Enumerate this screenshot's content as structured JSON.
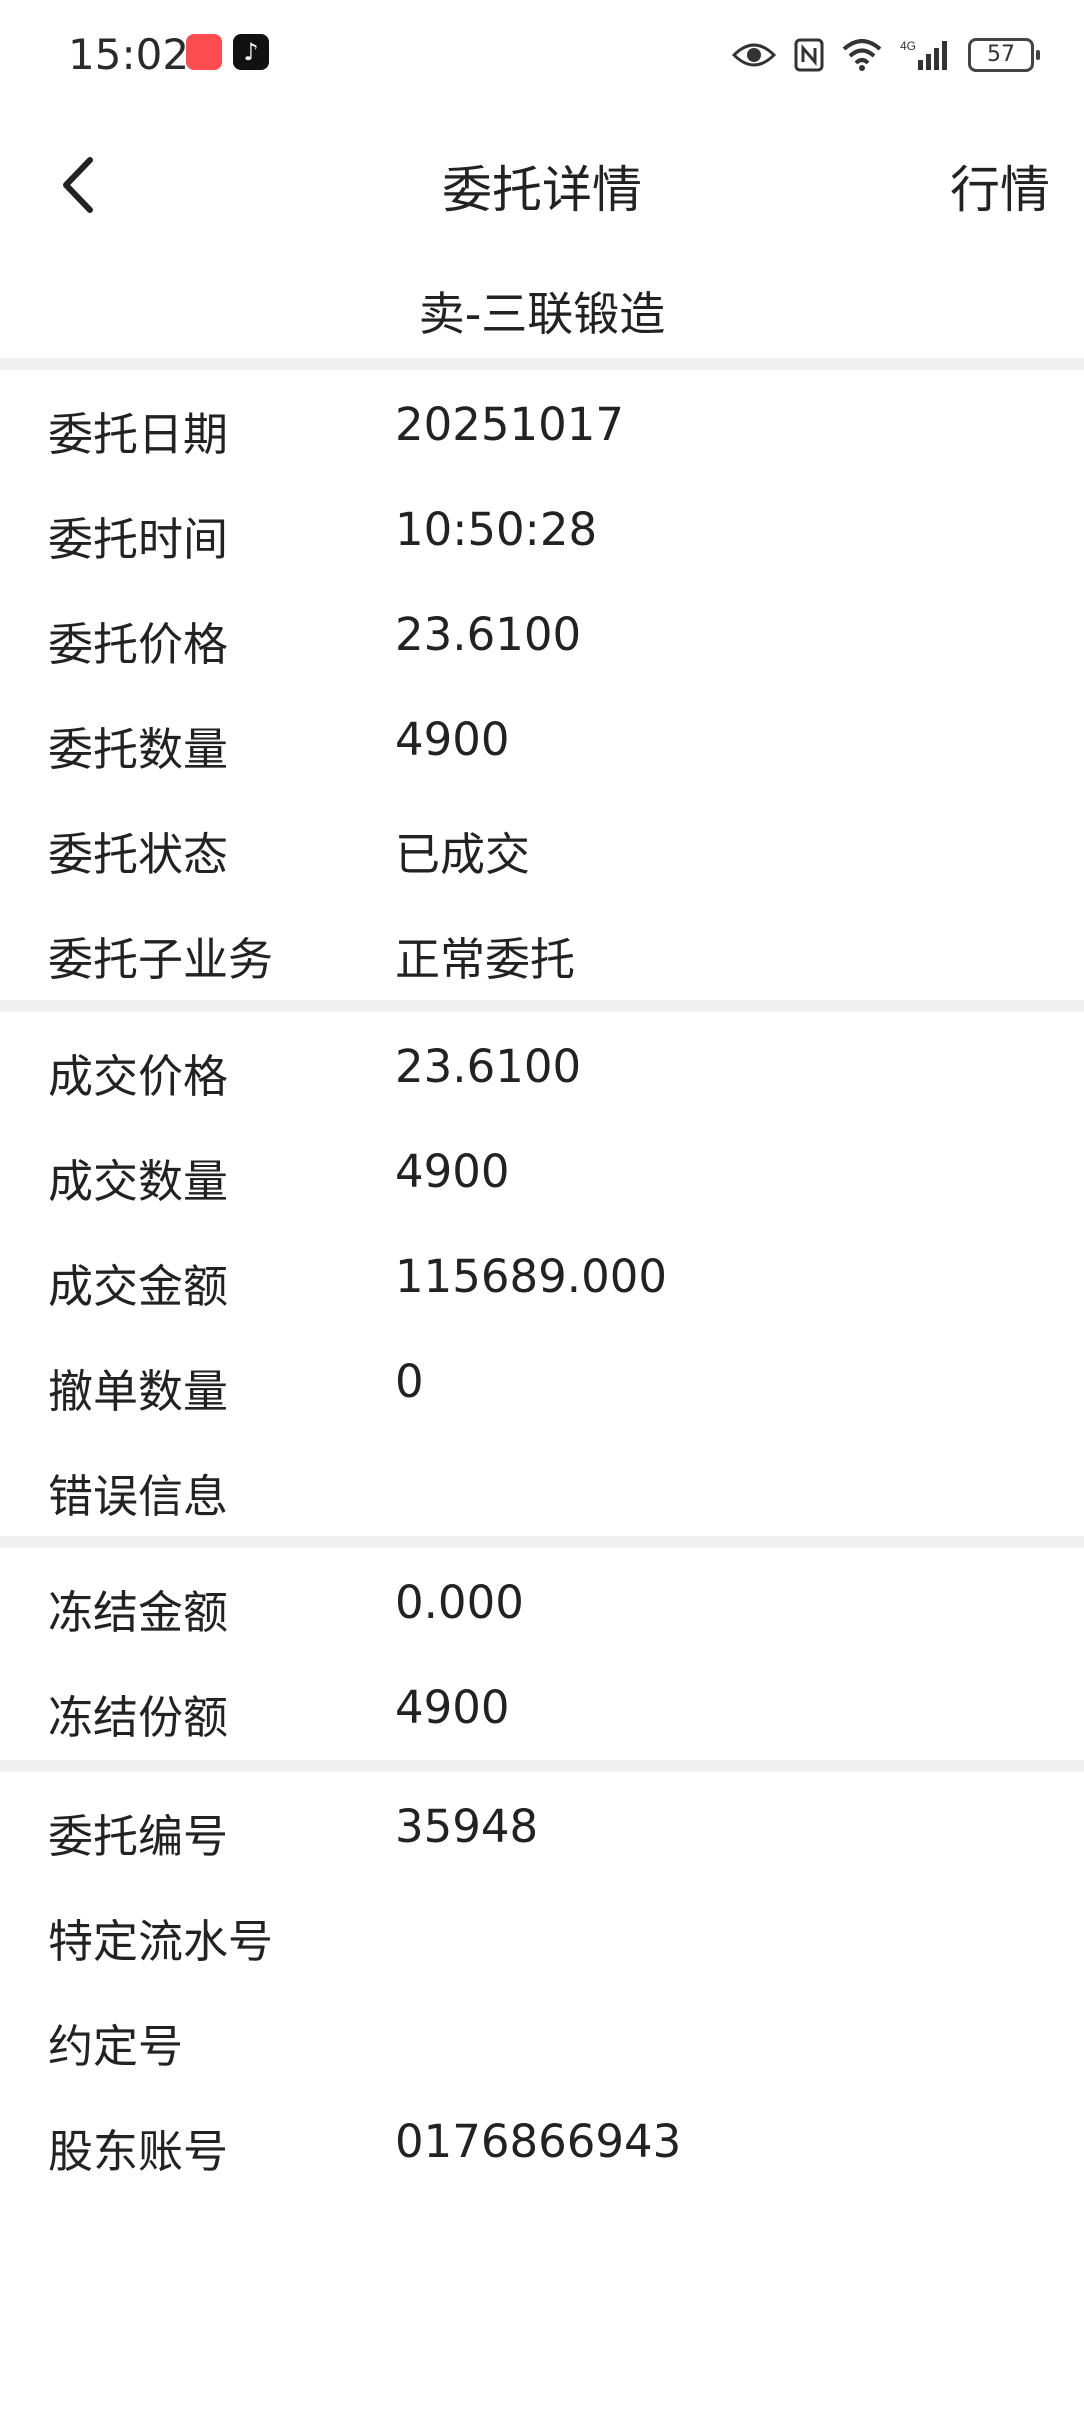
{
  "status_bar": {
    "time": "15:02",
    "battery": "57"
  },
  "nav": {
    "title": "委托详情",
    "right_action": "行情"
  },
  "subtitle": "卖-三联锻造",
  "sections": [
    [
      {
        "label": "委托日期",
        "value": "20251017"
      },
      {
        "label": "委托时间",
        "value": "10:50:28"
      },
      {
        "label": "委托价格",
        "value": "23.6100"
      },
      {
        "label": "委托数量",
        "value": "4900"
      },
      {
        "label": "委托状态",
        "value": "已成交"
      },
      {
        "label": "委托子业务",
        "value": "正常委托"
      }
    ],
    [
      {
        "label": "成交价格",
        "value": "23.6100"
      },
      {
        "label": "成交数量",
        "value": "4900"
      },
      {
        "label": "成交金额",
        "value": "115689.000"
      },
      {
        "label": "撤单数量",
        "value": "0"
      },
      {
        "label": "错误信息",
        "value": ""
      }
    ],
    [
      {
        "label": "冻结金额",
        "value": "0.000"
      },
      {
        "label": "冻结份额",
        "value": "4900"
      }
    ],
    [
      {
        "label": "委托编号",
        "value": "35948"
      },
      {
        "label": "特定流水号",
        "value": ""
      },
      {
        "label": "约定号",
        "value": ""
      },
      {
        "label": "股东账号",
        "value": "0176866943"
      }
    ]
  ]
}
